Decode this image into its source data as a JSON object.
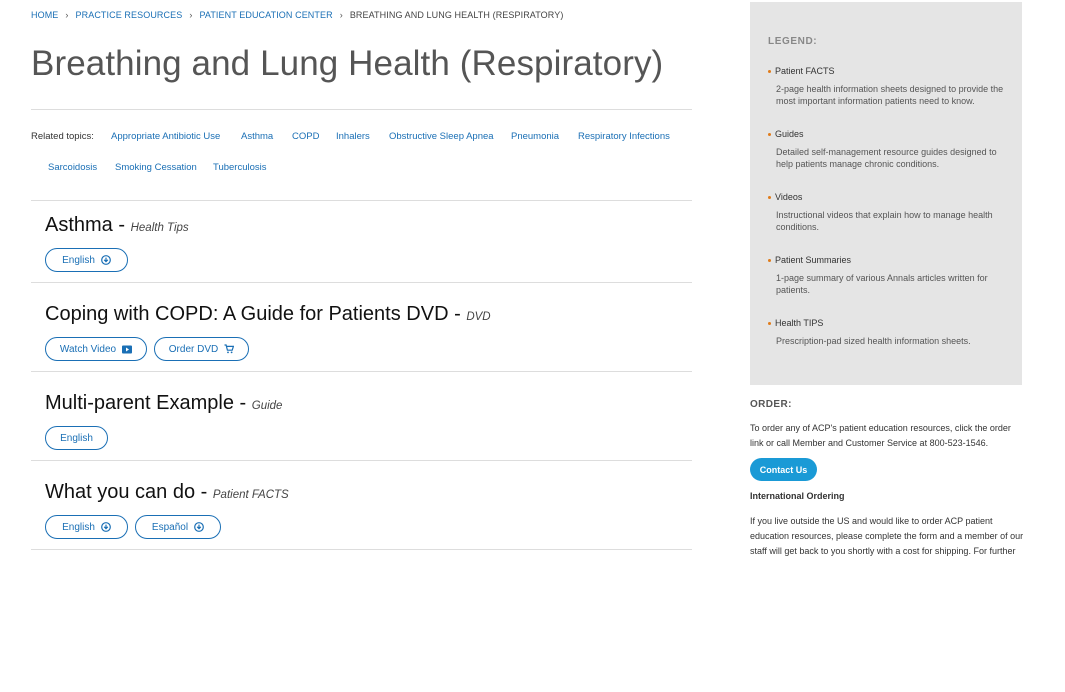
{
  "breadcrumb": {
    "home": "HOME",
    "practice": "PRACTICE RESOURCES",
    "center": "PATIENT EDUCATION CENTER",
    "current": "BREATHING AND LUNG HEALTH (RESPIRATORY)"
  },
  "page_title": "Breathing and Lung Health (Respiratory)",
  "related": {
    "label": "Related topics:",
    "topics": [
      "Appropriate Antibiotic Use",
      "Asthma",
      "COPD",
      "Inhalers",
      "Obstructive Sleep Apnea",
      "Pneumonia",
      "Respiratory Infections",
      "Sarcoidosis",
      "Smoking Cessation",
      "Tuberculosis"
    ]
  },
  "resources": [
    {
      "title": "Asthma",
      "type": "Health Tips",
      "buttons": [
        {
          "label": "English",
          "icon": "download-icon"
        }
      ]
    },
    {
      "title": "Coping with COPD: A Guide for Patients DVD",
      "type": "DVD",
      "buttons": [
        {
          "label": "Watch Video",
          "icon": "video-icon"
        },
        {
          "label": "Order DVD",
          "icon": "cart-icon"
        }
      ]
    },
    {
      "title": "Multi-parent Example",
      "type": "Guide",
      "buttons": [
        {
          "label": "English",
          "icon": ""
        }
      ]
    },
    {
      "title": "What you can do",
      "type": "Patient FACTS",
      "buttons": [
        {
          "label": "English",
          "icon": "download-icon"
        },
        {
          "label": "Español",
          "icon": "download-icon"
        }
      ]
    }
  ],
  "legend": {
    "title": "LEGEND:",
    "items": [
      {
        "name": "Patient FACTS",
        "desc": "2-page health information sheets designed to provide the most important information patients need to know."
      },
      {
        "name": "Guides",
        "desc": "Detailed self-management resource guides designed to help patients manage chronic conditions."
      },
      {
        "name": "Videos",
        "desc": "Instructional videos that explain how to manage health conditions."
      },
      {
        "name": "Patient Summaries",
        "desc": "1-page summary of various Annals articles written for patients."
      },
      {
        "name": "Health TIPS",
        "desc": "Prescription-pad sized health information sheets."
      }
    ]
  },
  "order": {
    "title": "ORDER:",
    "text": "To order any of ACP's patient education resources, click the order link or call Member and Customer Service at 800-523-1546.",
    "contact_label": "Contact Us",
    "intl_title": "International Ordering",
    "intl_text": "If you live outside the US and would like to order ACP patient education resources, please complete the form and a member of our staff will get back to you shortly with a cost for shipping. For further"
  },
  "colors": {
    "link": "#1a6fb5",
    "accent_bullet": "#e07b1a",
    "button": "#1a9ad6",
    "legend_bg": "#e5e5e5"
  }
}
